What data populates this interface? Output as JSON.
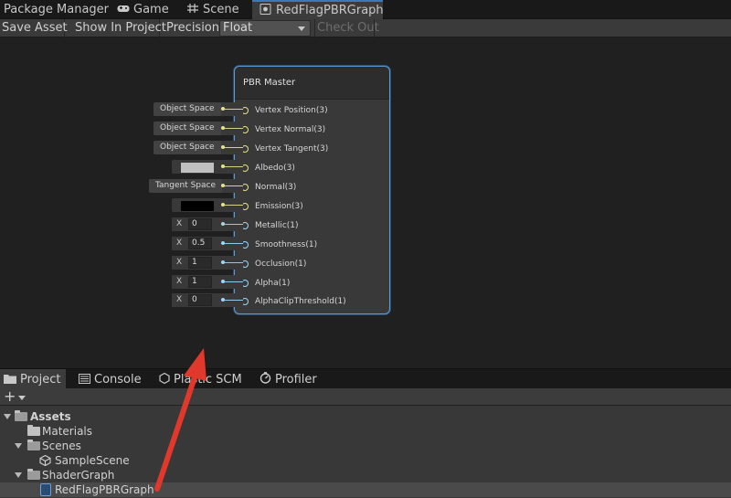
{
  "tabs": [
    {
      "label": "Package Manager",
      "icon": "none"
    },
    {
      "label": "Game",
      "icon": "gamepad-icon"
    },
    {
      "label": "Scene",
      "icon": "grid-icon"
    },
    {
      "label": "RedFlagPBRGraph",
      "icon": "shader-graph-icon",
      "active": true
    }
  ],
  "toolbar": {
    "save_asset": "Save Asset",
    "show_in_project": "Show In Project",
    "precision_label": "Precision",
    "precision_value": "Float",
    "check_out": "Check Out"
  },
  "node": {
    "title": "PBR Master",
    "ports": [
      {
        "label": "Vertex Position(3)",
        "input": "Object Space",
        "type": "vector"
      },
      {
        "label": "Vertex Normal(3)",
        "input": "Object Space",
        "type": "vector"
      },
      {
        "label": "Vertex Tangent(3)",
        "input": "Object Space",
        "type": "vector"
      },
      {
        "label": "Albedo(3)",
        "input": "color",
        "type": "vector"
      },
      {
        "label": "Normal(3)",
        "input": "Tangent Space",
        "type": "vector"
      },
      {
        "label": "Emission(3)",
        "input": "color",
        "type": "vector"
      },
      {
        "label": "Metallic(1)",
        "input_x": "X",
        "input_value": "0",
        "type": "float"
      },
      {
        "label": "Smoothness(1)",
        "input_x": "X",
        "input_value": "0.5",
        "type": "float"
      },
      {
        "label": "Occlusion(1)",
        "input_x": "X",
        "input_value": "1",
        "type": "float"
      },
      {
        "label": "Alpha(1)",
        "input_x": "X",
        "input_value": "1",
        "type": "float"
      },
      {
        "label": "AlphaClipThreshold(1)",
        "input_x": "X",
        "input_value": "0",
        "type": "float"
      }
    ],
    "albedo_color": "#c0c0c0",
    "emission_color": "#000000"
  },
  "bottom_tabs": [
    {
      "label": "Project",
      "icon": "folder-icon",
      "active": true
    },
    {
      "label": "Console",
      "icon": "console-icon"
    },
    {
      "label": "Plastic SCM",
      "icon": "plastic-scm-icon"
    },
    {
      "label": "Profiler",
      "icon": "profiler-icon"
    }
  ],
  "project_tree": [
    {
      "label": "Assets",
      "depth": 0,
      "icon": "folder-open-icon",
      "expanded": true,
      "bold": true
    },
    {
      "label": "Materials",
      "depth": 1,
      "icon": "folder-icon"
    },
    {
      "label": "Scenes",
      "depth": 1,
      "icon": "folder-open-icon",
      "expanded": true
    },
    {
      "label": "SampleScene",
      "depth": 2,
      "icon": "unity-scene-icon"
    },
    {
      "label": "ShaderGraph",
      "depth": 1,
      "icon": "folder-open-icon",
      "expanded": true
    },
    {
      "label": "RedFlagPBRGraph",
      "depth": 2,
      "icon": "shader-graph-icon",
      "selected": true
    }
  ],
  "colors": {
    "accent_blue": "#3a79bb",
    "node_border": "#5d9ad1",
    "vector_port": "#e6e28a",
    "float_port": "#9ed6f5",
    "annotation_arrow": "#e0392b"
  }
}
